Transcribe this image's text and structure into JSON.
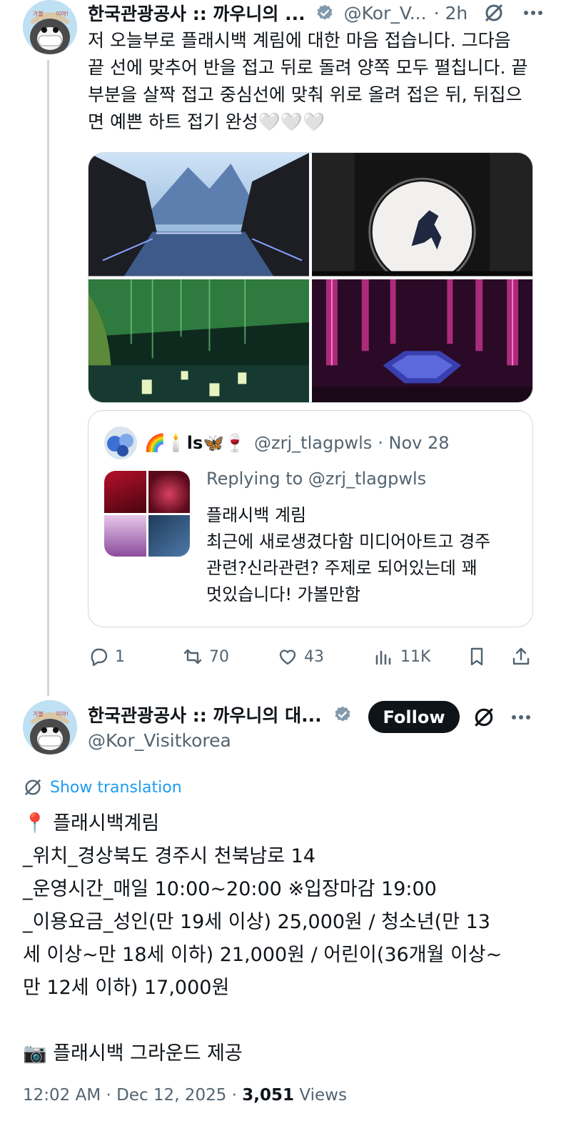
{
  "colors": {
    "accent": "#1d9bf0",
    "text": "#0f1419",
    "muted": "#536471",
    "border": "#cfd9de",
    "verified": "#829aab"
  },
  "tweet1": {
    "author_name": "한국관광공사 :: 까우니의 ...",
    "handle": "@Kor_V...",
    "time": "· 2h",
    "body": "저 오늘부로 플래시백 계림에 대한 마음 접습니다. 그다음\n끝 선에 맞추어 반을 접고 뒤로 돌려 양쪽 모두 펼칩니다. 끝\n부분을 살짝 접고 중심선에 맞춰 위로 올려 접은 뒤, 뒤집으\n면 예쁜 하트 접기 완성🤍🤍🤍",
    "quote": {
      "author_name": "🌈🕯️ls🦋🍷",
      "handle": "@zrj_tlagpwls",
      "date": "· Nov 28",
      "replying_to": "Replying to @zrj_tlagpwls",
      "body": "플래시백 계림\n최근에 새로생겼다함 미디어아트고 경주\n관련?신라관련? 주제로 되어있는데 꽤\n멋있습니다! 가볼만함"
    },
    "stats": {
      "replies": "1",
      "reposts": "70",
      "likes": "43",
      "views": "11K"
    }
  },
  "tweet2": {
    "author_name": "한국관광공사 :: 까우니의 대...",
    "handle": "@Kor_Visitkorea",
    "follow_label": "Follow",
    "show_translation": "Show translation",
    "body": "📍 플래시백계림\n_위치_경상북도 경주시 천북남로 14\n_운영시간_매일 10:00~20:00 ※입장마감 19:00\n_이용요금_성인(만 19세 이상) 25,000원 / 청소년(만 13\n세 이상~만 18세 이하) 21,000원 / 어린이(36개월 이상~\n만 12세 이하) 17,000원\n\n📷 플래시백 그라운드 제공",
    "timestamp": "12:02 AM · Dec 12, 2025 · ",
    "views_count": "3,051",
    "views_label": " Views"
  }
}
